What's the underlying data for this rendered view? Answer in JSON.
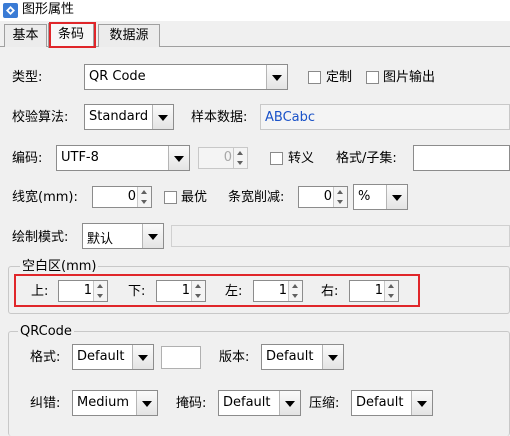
{
  "window": {
    "title": "图形属性"
  },
  "tabs": [
    "基本",
    "条码",
    "数据源"
  ],
  "type_row": {
    "label": "类型:",
    "value": "QR Code",
    "custom_label": "定制",
    "image_output_label": "图片输出"
  },
  "check_row": {
    "label": "校验算法:",
    "value": "Standard",
    "sample_label": "样本数据:",
    "sample_value": "ABCabc"
  },
  "encoding_row": {
    "label": "编码:",
    "value": "UTF-8",
    "disabled_spin_value": "0",
    "escape_label": "转义",
    "format_label": "格式/子集:"
  },
  "line_row": {
    "label": "线宽(mm):",
    "width_value": "0",
    "optimal_label": "最优",
    "reduce_label": "条宽削减:",
    "reduce_value": "0",
    "unit_value": "%"
  },
  "draw_row": {
    "label": "绘制模式:",
    "value": "默认"
  },
  "quiet_zone": {
    "title": "空白区(mm)",
    "top_label": "上:",
    "top_value": "1",
    "bottom_label": "下:",
    "bottom_value": "1",
    "left_label": "左:",
    "left_value": "1",
    "right_label": "右:",
    "right_value": "1"
  },
  "qrcode": {
    "title": "QRCode",
    "format_label": "格式:",
    "format_value": "Default",
    "version_label": "版本:",
    "version_value": "Default",
    "ecc_label": "纠错:",
    "ecc_value": "Medium",
    "mask_label": "掩码:",
    "mask_value": "Default",
    "compress_label": "压缩:",
    "compress_value": "Default"
  },
  "colors": {
    "highlight_red": "#e0262a",
    "sample_text": "#1a52c8",
    "title_icon": "#3a7bd5"
  }
}
